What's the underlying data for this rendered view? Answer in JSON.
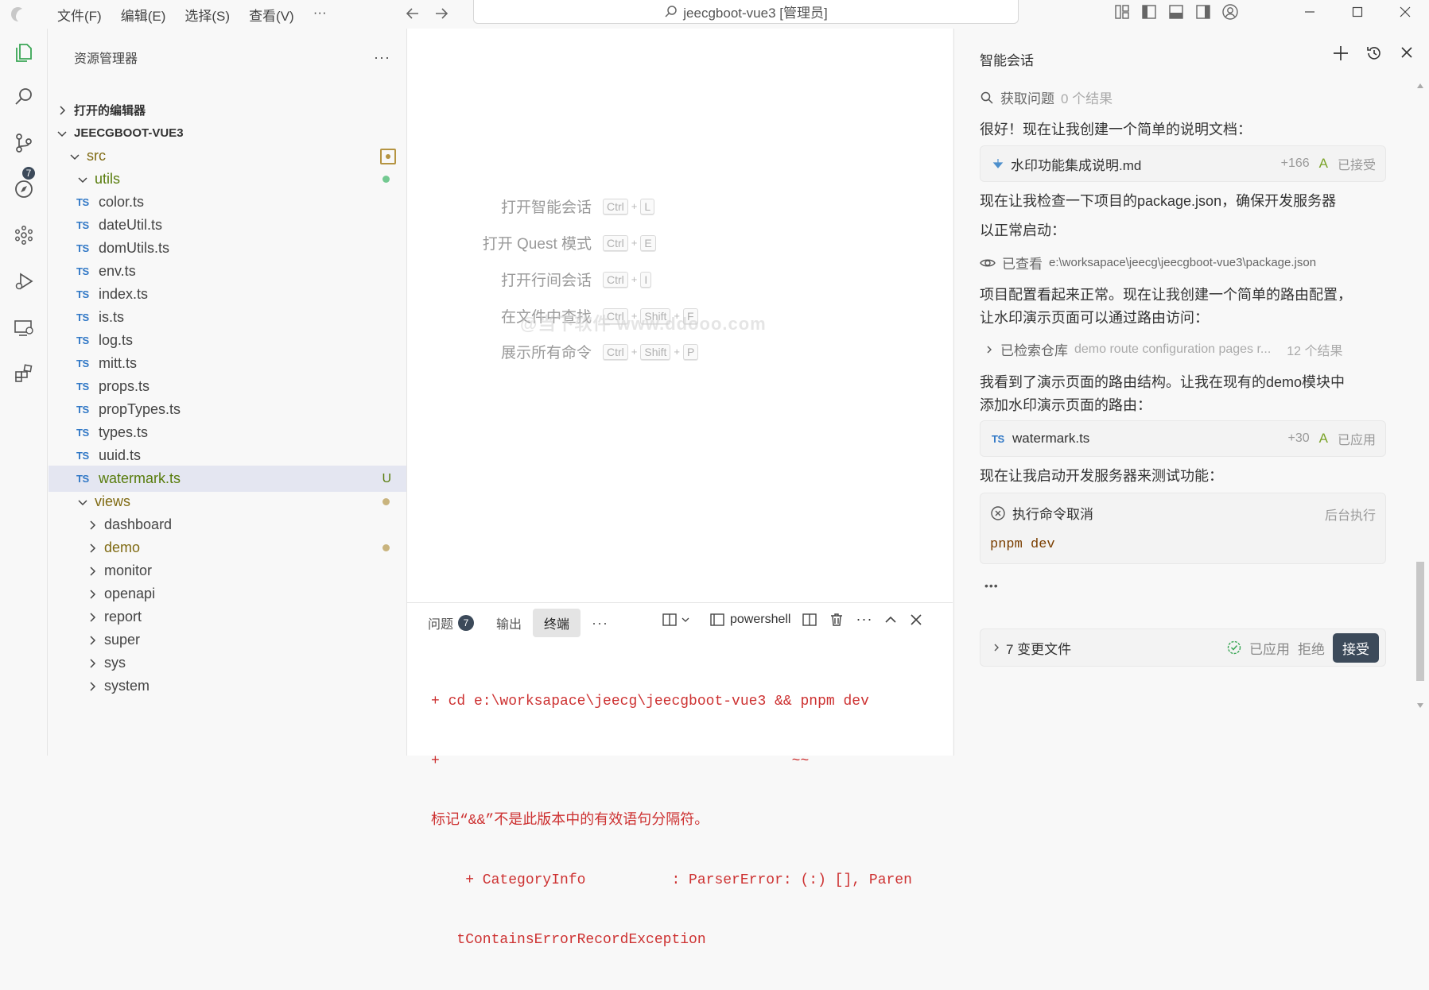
{
  "titlebar": {
    "menu": [
      "文件(F)",
      "编辑(E)",
      "选择(S)",
      "查看(V)",
      "···"
    ],
    "search_text": "jeecgboot-vue3 [管理员]"
  },
  "activity": {
    "scm_badge": "7"
  },
  "explorer": {
    "title": "资源管理器",
    "more": "···",
    "open_editors": "打开的编辑器",
    "project": "JEECGBOOT-VUE3",
    "src": "src",
    "utils": "utils",
    "files": [
      "color.ts",
      "dateUtil.ts",
      "domUtils.ts",
      "env.ts",
      "index.ts",
      "is.ts",
      "log.ts",
      "mitt.ts",
      "props.ts",
      "propTypes.ts",
      "types.ts",
      "uuid.ts",
      "watermark.ts"
    ],
    "ts_label": "TS",
    "watermark_status": "U",
    "views": "views",
    "view_folders": [
      "dashboard",
      "demo",
      "monitor",
      "openapi",
      "report",
      "super",
      "sys",
      "system"
    ]
  },
  "editor": {
    "hints": [
      {
        "label": "打开智能会话",
        "keys": [
          "Ctrl",
          "L"
        ]
      },
      {
        "label": "打开 Quest 模式",
        "keys": [
          "Ctrl",
          "E"
        ]
      },
      {
        "label": "打开行间会话",
        "keys": [
          "Ctrl",
          "I"
        ]
      },
      {
        "label": "在文件中查找",
        "keys": [
          "Ctrl",
          "Shift",
          "F"
        ]
      },
      {
        "label": "展示所有命令",
        "keys": [
          "Ctrl",
          "Shift",
          "P"
        ]
      }
    ],
    "plus": "+",
    "watermark": "@当下软件 www.ddooo.com"
  },
  "panel": {
    "tabs": [
      "问题",
      "输出",
      "终端"
    ],
    "problems_badge": "7",
    "more": "···",
    "shell": "powershell",
    "terminal_lines": [
      "+ cd e:\\worksapace\\jeecg\\jeecgboot-vue3 && pnpm dev",
      "+                                         ~~",
      "标记“&&”不是此版本中的有效语句分隔符。",
      "    + CategoryInfo          : ParserError: (:) [], Paren",
      "   tContainsErrorRecordException"
    ]
  },
  "chat": {
    "title": "智能会话",
    "search_issues": "获取问题",
    "search_issues_result": "0 个结果",
    "msg1": "很好！现在让我创建一个简单的说明文档：",
    "file1": {
      "name": "水印功能集成说明.md",
      "diff": "+166",
      "letter": "A",
      "status": "已接受"
    },
    "msg2_line1": "现在让我检查一下项目的package.json，确保开发服务器",
    "msg2_line2": "以正常启动：",
    "viewed_label": "已查看",
    "viewed_path": "e:\\worksapace\\jeecg\\jeecgboot-vue3\\package.json",
    "msg3_line1": "项目配置看起来正常。现在让我创建一个简单的路由配置，",
    "msg3_line2": "让水印演示页面可以通过路由访问：",
    "searched_label": "已检索仓库",
    "searched_query": "demo route configuration pages r...",
    "searched_result": "12 个结果",
    "msg4_line1": "我看到了演示页面的路由结构。让我在现有的demo模块中",
    "msg4_line2": "添加水印演示页面的路由：",
    "file2": {
      "prefix": "TS",
      "name": "watermark.ts",
      "diff": "+30",
      "letter": "A",
      "status": "已应用"
    },
    "msg5": "现在让我启动开发服务器来测试功能：",
    "cmd_title": "执行命令取消",
    "cmd_bg": "后台执行",
    "cmd_code": "pnpm dev",
    "ellipsis": "•••",
    "changes": "7 变更文件",
    "applied": "已应用",
    "reject": "拒绝",
    "accept": "接受"
  },
  "colors": {
    "accent": "#3178c6",
    "modified": "#7f6a12",
    "added": "#587c0c",
    "error": "#cd3131"
  }
}
